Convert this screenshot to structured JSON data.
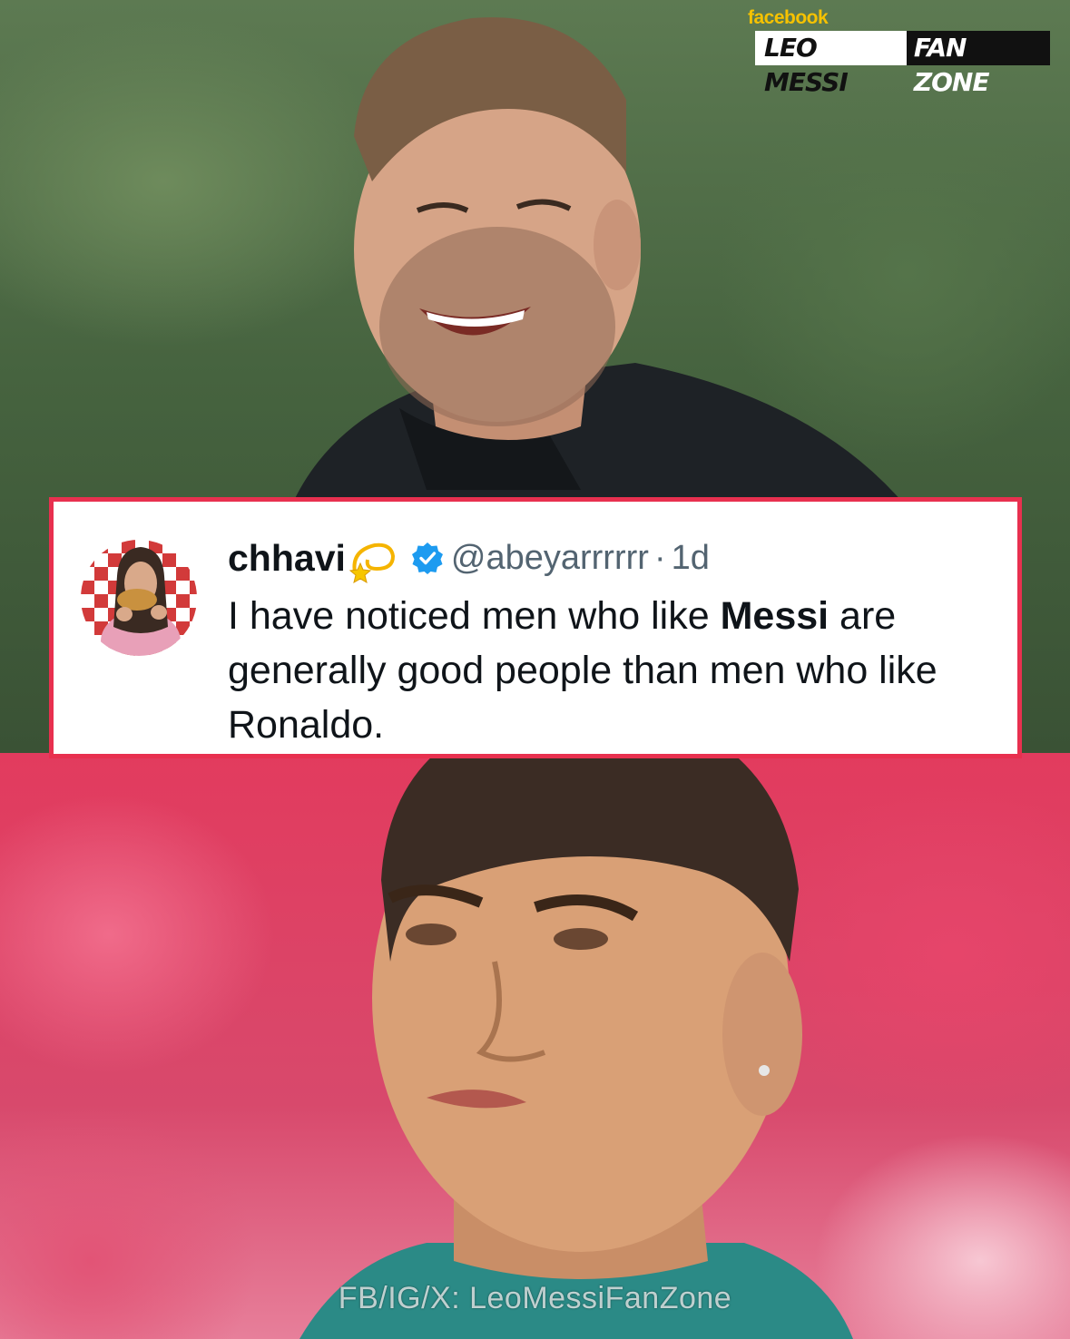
{
  "brand": {
    "platform": "facebook",
    "name_left": "LEO MESSI",
    "name_right": "FAN ZONE",
    "platform_color": "#f6c200"
  },
  "tweet": {
    "display_name": "chhavi",
    "name_emoji": "dizzy-star-icon",
    "verified": "verified-badge-icon",
    "handle": "@abeyarrrrrr",
    "separator": "·",
    "time": "1d",
    "text_before": "I have noticed men who like ",
    "text_bold": "Messi",
    "text_after": " are generally good people than men who like Ronaldo.",
    "border_color": "#e8304f",
    "verified_color": "#1d9bf0"
  },
  "photos": {
    "top": "smiling-man-photo",
    "bottom": "grimacing-man-photo"
  },
  "watermark": "FB/IG/X: LeoMessiFanZone"
}
